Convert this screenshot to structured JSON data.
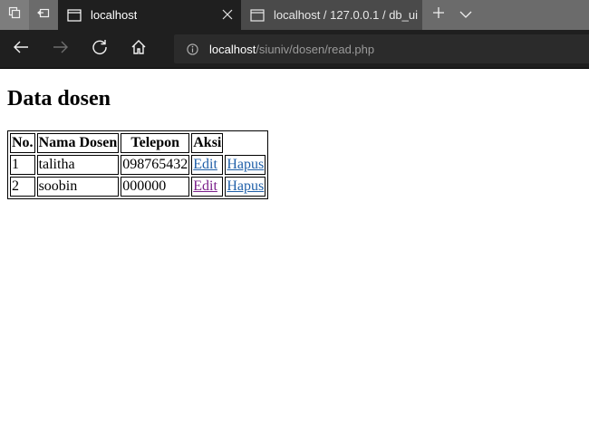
{
  "browser": {
    "tabs": [
      {
        "title": "localhost",
        "active": true
      },
      {
        "title": "localhost / 127.0.0.1 / db_ui",
        "active": false
      }
    ],
    "address": {
      "host": "localhost",
      "path": "/siuniv/dosen/read.php"
    },
    "icons": {
      "tab_actions": "tab-actions-icon",
      "set_aside": "set-aside-tabs-icon",
      "page": "page-icon",
      "close": "close-icon",
      "new_tab": "plus-icon",
      "tab_menu": "chevron-down-icon",
      "back": "back-arrow-icon",
      "forward": "forward-arrow-icon",
      "refresh": "refresh-icon",
      "home": "home-icon",
      "site_info": "info-icon"
    }
  },
  "page": {
    "heading": "Data dosen",
    "table": {
      "headers": [
        "No.",
        "Nama Dosen",
        "Telepon",
        "Aksi"
      ],
      "rows": [
        {
          "no": "1",
          "nama": "talitha",
          "telepon": "098765432",
          "edit": "Edit",
          "hapus": "Hapus"
        },
        {
          "no": "2",
          "nama": "soobin",
          "telepon": "000000",
          "edit": "Edit",
          "hapus": "Hapus"
        }
      ]
    },
    "colors": {
      "link": "#1f5fa8",
      "visited_link": "#7a1f8a"
    }
  }
}
